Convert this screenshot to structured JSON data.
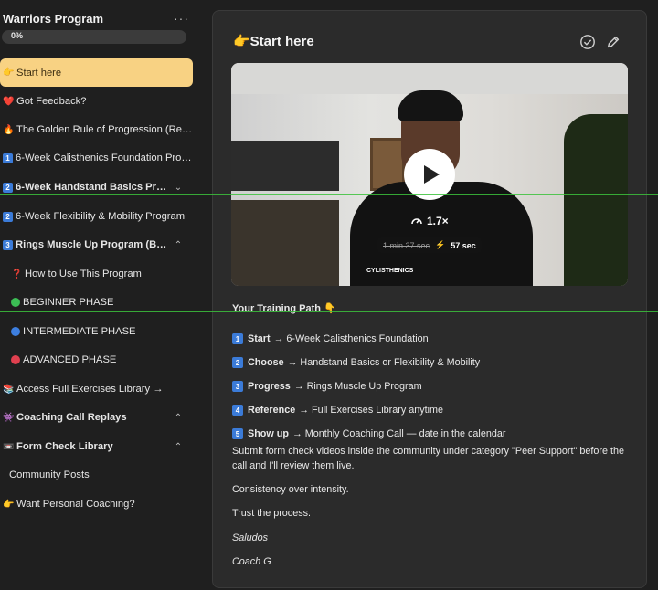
{
  "sidebar": {
    "title": "Warriors Program",
    "more_label": "···",
    "progress_text": "0%",
    "progress_value": 0,
    "items": [
      {
        "emoji": "👉",
        "label": "Start here",
        "active": true
      },
      {
        "emoji": "❤️",
        "label": "Got Feedback?"
      },
      {
        "emoji": "🔥",
        "label": "The Golden Rule of Progression (Read ..."
      },
      {
        "badge": "1",
        "label": "6-Week Calisthenics Foundation Progr..."
      },
      {
        "badge": "2",
        "label": "6-Week Handstand Basics Progr...",
        "bold": true,
        "chevron": "down"
      },
      {
        "badge": "2",
        "label": "6-Week Flexibility & Mobility Program"
      },
      {
        "badge": "3",
        "label": "Rings Muscle Up Program (Begi...",
        "bold": true,
        "chevron": "up"
      },
      {
        "emoji": "❓",
        "label": "How to Use This Program",
        "sub": true
      },
      {
        "dot": "#3cbf55",
        "label": "BEGINNER PHASE",
        "sub": true
      },
      {
        "dot": "#3d7fe0",
        "label": "INTERMEDIATE PHASE",
        "sub": true
      },
      {
        "dot": "#e0404f",
        "label": "ADVANCED PHASE",
        "sub": true
      },
      {
        "emoji": "📚",
        "label": "Access Full Exercises Library →"
      },
      {
        "emoji": "👾",
        "label": "Coaching Call Replays",
        "bold": true,
        "chevron": "up"
      },
      {
        "emoji": "📼",
        "label": "Form Check Library",
        "bold": true,
        "chevron": "up"
      },
      {
        "label": "Community Posts",
        "plain": true
      },
      {
        "emoji": "👉",
        "label": "Want Personal Coaching?"
      }
    ]
  },
  "panel": {
    "title": "👉Start here",
    "video": {
      "speed": "1.7×",
      "old_time": "1 min 37 sec",
      "new_time": "57 sec",
      "jacket_text": "CYLISTHENICS"
    },
    "training_title": "Your Training Path 👇",
    "steps": [
      {
        "badge": "1",
        "bold": "Start",
        "text": "→ 6-Week Calisthenics Foundation"
      },
      {
        "badge": "2",
        "bold": "Choose",
        "text": "→ Handstand Basics or Flexibility & Mobility"
      },
      {
        "badge": "3",
        "bold": "Progress",
        "text": "→ Rings Muscle Up Program"
      },
      {
        "badge": "4",
        "bold": "Reference",
        "text": "→ Full Exercises Library anytime"
      },
      {
        "badge": "5",
        "bold": "Show up",
        "text": "→ Monthly Coaching Call — date in the calendar"
      }
    ],
    "para1": "Submit form check videos inside the community under category \"Peer Support\" before the call and I'll review them live.",
    "para2": "Consistency over intensity.",
    "para3": "Trust the process.",
    "sign1": "Saludos",
    "sign2": "Coach G"
  }
}
